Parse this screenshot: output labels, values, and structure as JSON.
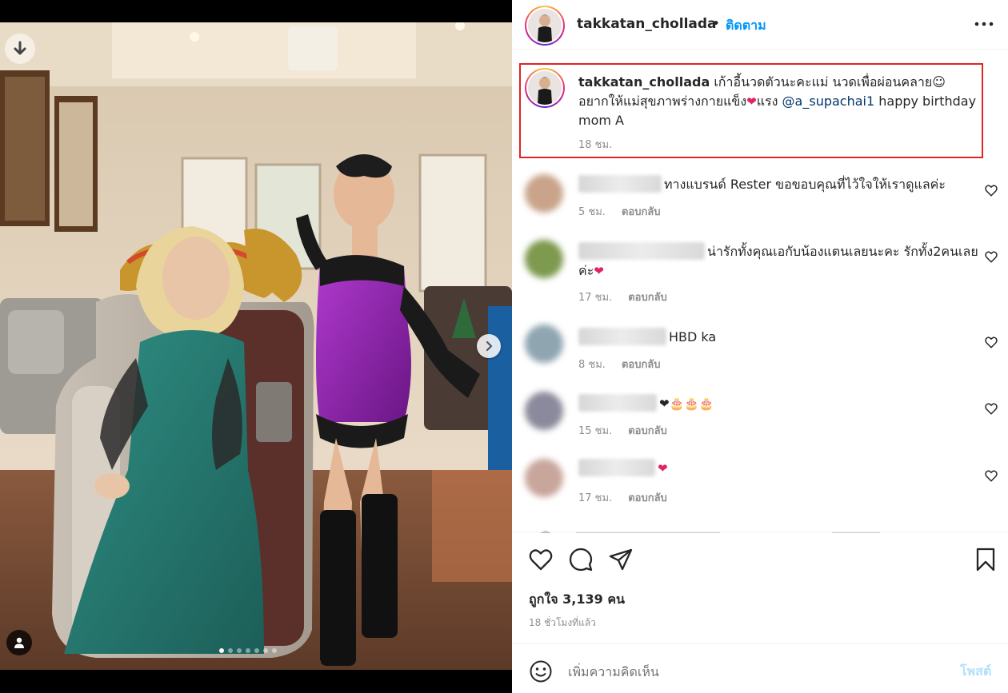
{
  "post": {
    "username": "takkatan_chollada",
    "follow_separator": "•",
    "follow_label": "ติดตาม",
    "more_icon": "more-horizontal-icon",
    "image_count": 7,
    "active_image": 1
  },
  "caption": {
    "username": "takkatan_chollada",
    "text_1": " เก้าอี้นวดตัวนะคะแม่ นวดเพื่อผ่อนคลาย☺ อยากให้แม่สุขภาพร่างกายแข็ง",
    "heart": "❤",
    "text_2": "แรง ",
    "mention": "@a_supachai1",
    "text_3": " happy birthday mom A",
    "time": "18 ชม."
  },
  "comments": [
    {
      "text": "ทางแบรนด์ Rester ขอขอบคุณที่ไว้ใจให้เราดูแลค่ะ",
      "time": "5 ชม.",
      "reply": "ตอบกลับ",
      "avatar_color": "#c9a48a"
    },
    {
      "text": "น่ารักทั้งคุณเอกับน้องแตนเลยนะคะ รักทั้ง2คนเลยค่ะ",
      "suffix": "❤",
      "time": "17 ชม.",
      "reply": "ตอบกลับ",
      "avatar_color": "#7e9a4e"
    },
    {
      "text": "HBD ka",
      "time": "8 ชม.",
      "reply": "ตอบกลับ",
      "avatar_color": "#8fa6b0"
    },
    {
      "text": "",
      "suffix": "❤🎂🎂🎂",
      "time": "15 ชม.",
      "reply": "ตอบกลับ",
      "avatar_color": "#8a8a9c"
    },
    {
      "text": "",
      "suffix": "❤",
      "time": "17 ชม.",
      "reply": "ตอบกลับ",
      "avatar_color": "#c8a69c"
    }
  ],
  "likes": {
    "label": "ถูกใจ 3,139 คน"
  },
  "post_time": "18 ชั่วโมงที่แล้ว",
  "add_comment": {
    "placeholder": "เพิ่มความคิดเห็น",
    "post_label": "โพสต์"
  },
  "colors": {
    "accent": "#0095f6",
    "highlight_border": "#e02424",
    "post_disabled": "#b2dffc",
    "mention": "#00376b"
  }
}
